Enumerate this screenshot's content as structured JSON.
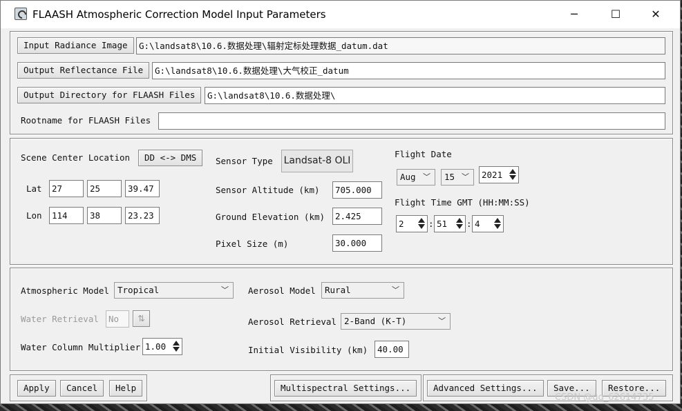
{
  "window": {
    "title": "FLAASH Atmospheric Correction Model Input Parameters",
    "minimize": "─",
    "maximize": "☐",
    "close": "✕"
  },
  "files": {
    "input_button": "Input Radiance Image",
    "input_path": "G:\\landsat8\\10.6.数据处理\\辐射定标处理数据_datum.dat",
    "output_button": "Output Reflectance File",
    "output_path": "G:\\landsat8\\10.6.数据处理\\大气校正_datum",
    "outdir_button": "Output Directory for FLAASH Files",
    "outdir_path": "G:\\landsat8\\10.6.数据处理\\",
    "rootname_label": "Rootname for FLAASH Files",
    "rootname_value": ""
  },
  "scene": {
    "center_label": "Scene Center Location",
    "dd_dms_button": "DD <-> DMS",
    "lat_label": "Lat",
    "lat": [
      "27",
      "25",
      "39.47"
    ],
    "lon_label": "Lon",
    "lon": [
      "114",
      "38",
      "23.23"
    ]
  },
  "sensor": {
    "type_label": "Sensor Type",
    "type_value": "Landsat-8 OLI",
    "altitude_label": "Sensor Altitude (km)",
    "altitude": "705.000",
    "elevation_label": "Ground Elevation (km)",
    "elevation": "2.425",
    "pixel_label": "Pixel Size (m)",
    "pixel": "30.000"
  },
  "flight": {
    "date_label": "Flight Date",
    "month": "Aug",
    "day": "15",
    "year": "2021",
    "time_label": "Flight Time GMT (HH:MM:SS)",
    "hh": "2",
    "mm": "51",
    "ss": "4",
    "sep": ":"
  },
  "atmos": {
    "model_label": "Atmospheric Model",
    "model_value": "Tropical",
    "water_label": "Water Retrieval",
    "water_value": "No",
    "multiplier_label": "Water Column Multiplier",
    "multiplier": "1.00",
    "aerosol_model_label": "Aerosol Model",
    "aerosol_model_value": "Rural",
    "aerosol_retrieval_label": "Aerosol Retrieval",
    "aerosol_retrieval_value": "2-Band (K-T)",
    "visibility_label": "Initial Visibility (km)",
    "visibility": "40.00"
  },
  "buttons": {
    "apply": "Apply",
    "cancel": "Cancel",
    "help": "Help",
    "multispectral": "Multispectral Settings...",
    "advanced": "Advanced Settings...",
    "save": "Save...",
    "restore": "Restore..."
  },
  "watermark": "CSDN @qq_62614735"
}
